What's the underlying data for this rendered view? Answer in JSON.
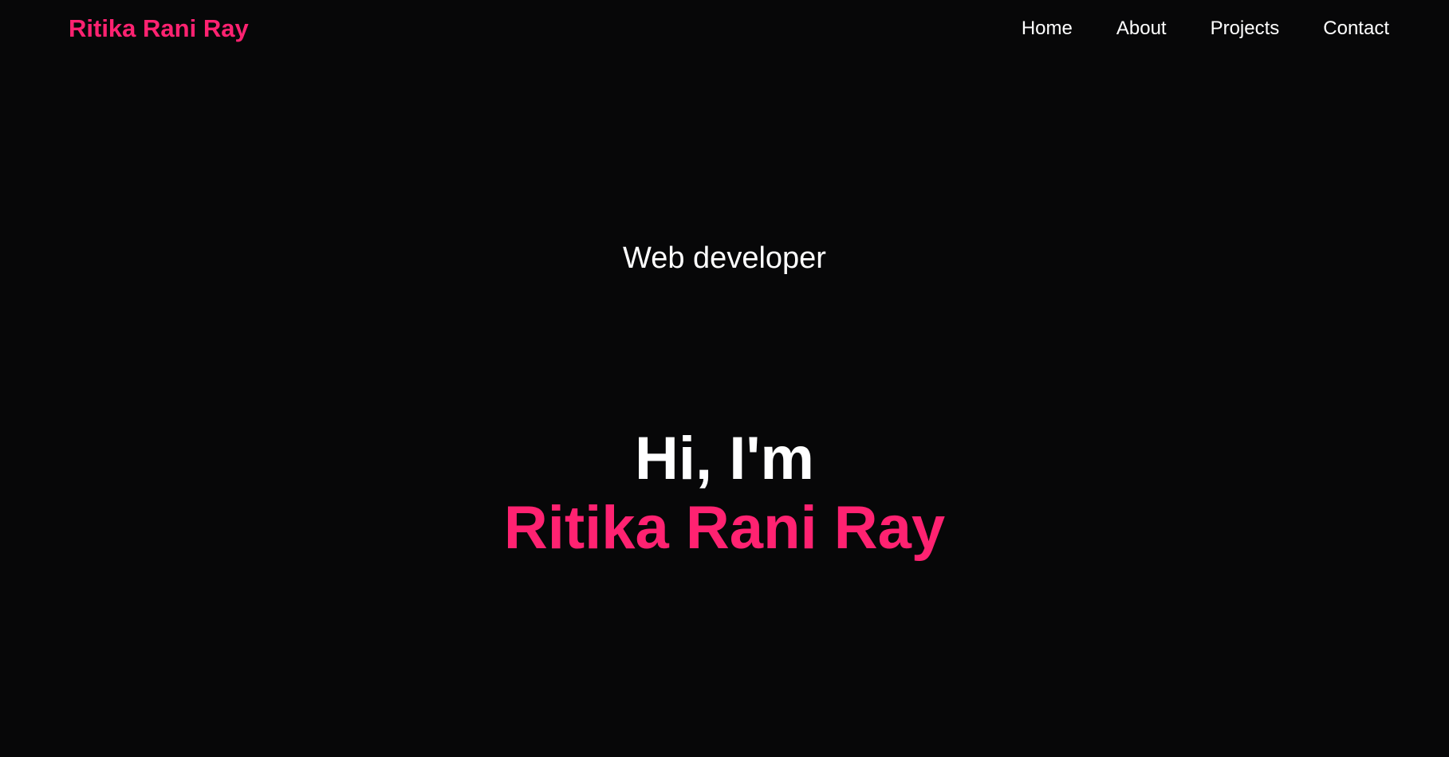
{
  "colors": {
    "background": "#070708",
    "accent": "#ff2271",
    "text": "#ffffff"
  },
  "header": {
    "brand": "Ritika Rani Ray",
    "nav": [
      {
        "label": "Home"
      },
      {
        "label": "About"
      },
      {
        "label": "Projects"
      },
      {
        "label": "Contact"
      }
    ]
  },
  "hero": {
    "role": "Web developer",
    "greeting": "Hi, I'm",
    "name": "Ritika Rani Ray"
  }
}
